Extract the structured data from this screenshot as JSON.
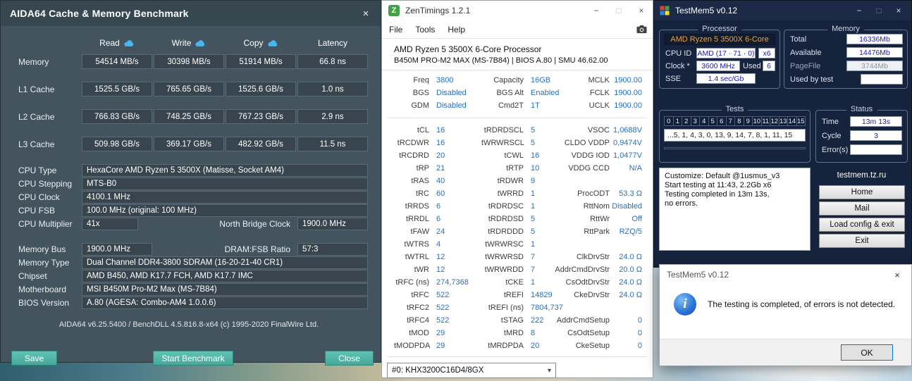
{
  "colors": {
    "aida_button_teal": "#54b9ad",
    "zen_value_blue": "#2570c7",
    "zen_icon_green": "#43a047",
    "tm5_value_blue": "#1a1ab8",
    "tm5_cpu_name_orange": "#e8a33c",
    "dialog_ok_accent": "#0078d7"
  },
  "aida64": {
    "title": "AIDA64 Cache & Memory Benchmark",
    "close": "×",
    "columns": {
      "read": "Read",
      "write": "Write",
      "copy": "Copy",
      "latency": "Latency"
    },
    "bench": [
      {
        "label": "Memory",
        "read": "54514 MB/s",
        "write": "30398 MB/s",
        "copy": "51914 MB/s",
        "latency": "66.8 ns"
      },
      {
        "label": "L1 Cache",
        "read": "1525.5 GB/s",
        "write": "765.65 GB/s",
        "copy": "1525.6 GB/s",
        "latency": "1.0 ns"
      },
      {
        "label": "L2 Cache",
        "read": "766.83 GB/s",
        "write": "748.25 GB/s",
        "copy": "767.23 GB/s",
        "latency": "2.9 ns"
      },
      {
        "label": "L3 Cache",
        "read": "509.98 GB/s",
        "write": "369.17 GB/s",
        "copy": "482.92 GB/s",
        "latency": "11.5 ns"
      }
    ],
    "info": [
      {
        "label": "CPU Type",
        "value": "HexaCore AMD Ryzen 5 3500X  (Matisse, Socket AM4)"
      },
      {
        "label": "CPU Stepping",
        "value": "MTS-B0"
      },
      {
        "label": "CPU Clock",
        "value": "4100.1 MHz"
      },
      {
        "label": "CPU FSB",
        "value": "100.0 MHz  (original: 100 MHz)"
      }
    ],
    "multiplier": {
      "label": "CPU Multiplier",
      "value": "41x",
      "nb_label": "North Bridge Clock",
      "nb_value": "1900.0 MHz"
    },
    "membus": {
      "label": "Memory Bus",
      "value": "1900.0 MHz",
      "ratio_label": "DRAM:FSB Ratio",
      "ratio_value": "57:3"
    },
    "info2": [
      {
        "label": "Memory Type",
        "value": "Dual Channel DDR4-3800 SDRAM  (16-20-21-40 CR1)"
      },
      {
        "label": "Chipset",
        "value": "AMD B450, AMD K17.7 FCH, AMD K17.7 IMC"
      },
      {
        "label": "Motherboard",
        "value": "MSI B450M Pro-M2 Max (MS-7B84)"
      },
      {
        "label": "BIOS Version",
        "value": "A.80  (AGESA: Combo-AM4 1.0.0.6)"
      }
    ],
    "footer": "AIDA64 v6.25.5400 / BenchDLL 4.5.816.8-x64  (c) 1995-2020 FinalWire Ltd.",
    "buttons": {
      "save": "Save",
      "start": "Start Benchmark",
      "close": "Close"
    }
  },
  "zentimings": {
    "title": "ZenTimings 1.2.1",
    "icon_letter": "Z",
    "window_controls": {
      "minimize": "−",
      "maximize": "□",
      "close": "×"
    },
    "menu": [
      "File",
      "Tools",
      "Help"
    ],
    "cpu": "AMD Ryzen 5 3500X 6-Core Processor",
    "board": "B450M PRO-M2 MAX (MS-7B84) | BIOS A.80 | SMU 46.62.00",
    "rows": [
      [
        "Freq",
        "3800",
        "Capacity",
        "16GB",
        "MCLK",
        "1900.00"
      ],
      [
        "BGS",
        "Disabled",
        "BGS Alt",
        "Enabled",
        "FCLK",
        "1900.00"
      ],
      [
        "GDM",
        "Disabled",
        "Cmd2T",
        "1T",
        "UCLK",
        "1900.00"
      ],
      [
        "tCL",
        "16",
        "tRDRDSCL",
        "5",
        "VSOC",
        "1,0688V"
      ],
      [
        "tRCDWR",
        "16",
        "tWRWRSCL",
        "5",
        "CLDO VDDP",
        "0,9474V"
      ],
      [
        "tRCDRD",
        "20",
        "tCWL",
        "16",
        "VDDG IOD",
        "1,0477V"
      ],
      [
        "tRP",
        "21",
        "tRTP",
        "10",
        "VDDG CCD",
        "N/A"
      ],
      [
        "tRAS",
        "40",
        "tRDWR",
        "9",
        "",
        ""
      ],
      [
        "tRC",
        "60",
        "tWRRD",
        "1",
        "ProcODT",
        "53.3 Ω"
      ],
      [
        "tRRDS",
        "6",
        "tRDRDSC",
        "1",
        "RttNom",
        "Disabled"
      ],
      [
        "tRRDL",
        "6",
        "tRDRDSD",
        "5",
        "RttWr",
        "Off"
      ],
      [
        "tFAW",
        "24",
        "tRDRDDD",
        "5",
        "RttPark",
        "RZQ/5"
      ],
      [
        "tWTRS",
        "4",
        "tWRWRSC",
        "1",
        "",
        ""
      ],
      [
        "tWTRL",
        "12",
        "tWRWRSD",
        "7",
        "ClkDrvStr",
        "24.0 Ω"
      ],
      [
        "tWR",
        "12",
        "tWRWRDD",
        "7",
        "AddrCmdDrvStr",
        "20.0 Ω"
      ],
      [
        "tRFC (ns)",
        "274,7368",
        "tCKE",
        "1",
        "CsOdtDrvStr",
        "24.0 Ω"
      ],
      [
        "tRFC",
        "522",
        "tREFI",
        "14829",
        "CkeDrvStr",
        "24.0 Ω"
      ],
      [
        "tRFC2",
        "522",
        "tREFI (ns)",
        "7804,737",
        "",
        ""
      ],
      [
        "tRFC4",
        "522",
        "tSTAG",
        "222",
        "AddrCmdSetup",
        "0"
      ],
      [
        "tMOD",
        "29",
        "tMRD",
        "8",
        "CsOdtSetup",
        "0"
      ],
      [
        "tMODPDA",
        "29",
        "tMRDPDA",
        "20",
        "CkeSetup",
        "0"
      ]
    ],
    "dram_select": "#0: KHX3200C16D4/8GX",
    "dram_select_arrow": "▾"
  },
  "testmem5": {
    "title": "TestMem5 v0.12",
    "window_controls": {
      "minimize": "−",
      "maximize": "□",
      "close": "×"
    },
    "processor": {
      "group_label": "Processor",
      "name": "AMD Ryzen 5 3500X 6-Core",
      "cpu_id_label": "CPU ID",
      "cpu_id_value": "AMD  (17 · 71 · 0)",
      "cpu_id_mult": "x6",
      "clock_label": "Clock *",
      "clock_value": "3600 MHz",
      "used_label": "Used",
      "used_value": "6",
      "sse_label": "SSE",
      "sse_value": "1.4 sec/Gb"
    },
    "memory": {
      "group_label": "Memory",
      "rows": [
        {
          "label": "Total",
          "value": "16336Mb"
        },
        {
          "label": "Available",
          "value": "14476Mb"
        },
        {
          "label": "PageFile",
          "value": "3744Mb"
        },
        {
          "label": "Used by test",
          "value": ""
        }
      ]
    },
    "tests": {
      "group_label": "Tests",
      "cells": [
        "0",
        "1",
        "2",
        "3",
        "4",
        "5",
        "6",
        "7",
        "8",
        "9",
        "10",
        "11",
        "12",
        "13",
        "14",
        "15"
      ],
      "sequence": "...5, 1, 4, 3, 0, 13, 9, 14, 7, 8, 1, 11, 15"
    },
    "status": {
      "group_label": "Status",
      "rows": [
        {
          "label": "Time",
          "value": "13m 13s"
        },
        {
          "label": "Cycle",
          "value": "3"
        },
        {
          "label": "Error(s)",
          "value": ""
        }
      ]
    },
    "log_lines": [
      "Customize: Default @1usmus_v3",
      "Start testing at 11:43, 2.2Gb x6",
      "Testing completed in 13m 13s,",
      "no errors."
    ],
    "site": "testmem.tz.ru",
    "buttons": [
      "Home",
      "Mail",
      "Load config & exit",
      "Exit"
    ]
  },
  "dialog": {
    "title": "TestMem5 v0.12",
    "close": "×",
    "icon_letter": "i",
    "message": "The testing is completed, of errors is not detected.",
    "ok": "OK"
  }
}
